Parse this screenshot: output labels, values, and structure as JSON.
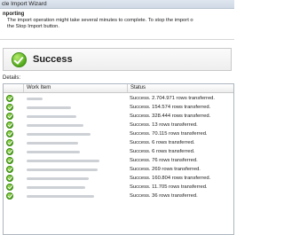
{
  "window": {
    "title": "cle Import Wizard"
  },
  "header": {
    "heading": "nporting",
    "description_line1": "The import operation might take several minutes to complete. To stop the import o",
    "description_line2": "the Stop Import button."
  },
  "status": {
    "text": "Success",
    "icon": "success-check-icon"
  },
  "details": {
    "label": "Details:",
    "columns": [
      "Work Item",
      "Status"
    ],
    "rows": [
      {
        "status": "Success. 2.704.971 rows transferred."
      },
      {
        "status": "Success. 154.574 rows transferred."
      },
      {
        "status": "Success. 328.444 rows transferred."
      },
      {
        "status": "Success. 13 rows transferred."
      },
      {
        "status": "Success. 70.115 rows transferred."
      },
      {
        "status": "Success. 6 rows transferred."
      },
      {
        "status": "Success. 6 rows transferred."
      },
      {
        "status": "Success. 76 rows transferred."
      },
      {
        "status": "Success. 269 rows transferred."
      },
      {
        "status": "Success. 160.804 rows transferred."
      },
      {
        "status": "Success. 11.705 rows transferred."
      },
      {
        "status": "Success. 36 rows transferred."
      }
    ]
  },
  "colors": {
    "success": "#4aa019",
    "accent": "#cfd9e5"
  }
}
